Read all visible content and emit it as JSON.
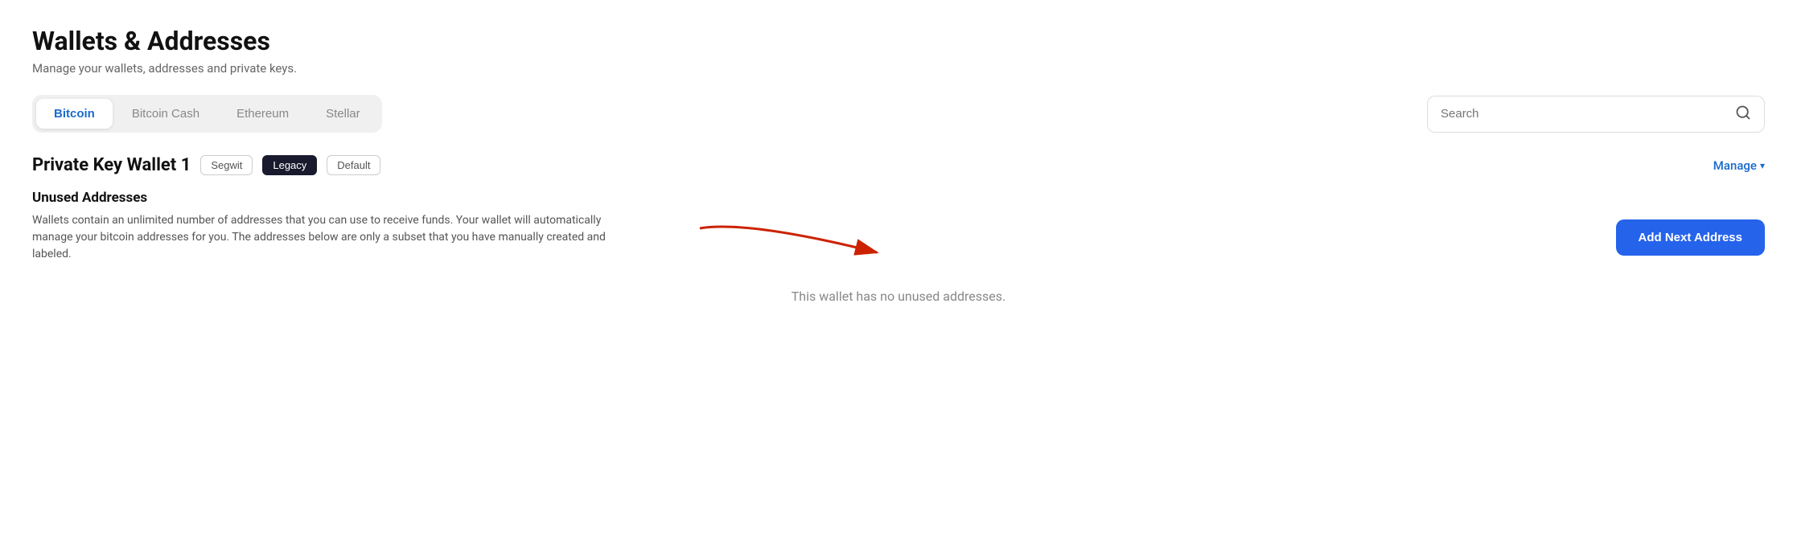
{
  "page": {
    "title": "Wallets & Addresses",
    "subtitle": "Manage your wallets, addresses and private keys."
  },
  "tabs": {
    "items": [
      {
        "id": "bitcoin",
        "label": "Bitcoin",
        "active": true
      },
      {
        "id": "bitcoin-cash",
        "label": "Bitcoin Cash",
        "active": false
      },
      {
        "id": "ethereum",
        "label": "Ethereum",
        "active": false
      },
      {
        "id": "stellar",
        "label": "Stellar",
        "active": false
      }
    ]
  },
  "search": {
    "placeholder": "Search"
  },
  "wallet": {
    "name": "Private Key Wallet 1",
    "badges": [
      {
        "id": "segwit",
        "label": "Segwit",
        "active": false
      },
      {
        "id": "legacy",
        "label": "Legacy",
        "active": true
      },
      {
        "id": "default",
        "label": "Default",
        "active": false
      }
    ],
    "manage_label": "Manage",
    "unused_title": "Unused Addresses",
    "unused_desc": "Wallets contain an unlimited number of addresses that you can use to receive funds. Your wallet will automatically manage your bitcoin addresses for you. The addresses below are only a subset that you have manually created and labeled.",
    "add_button_label": "Add Next Address",
    "empty_state": "This wallet has no unused addresses."
  }
}
